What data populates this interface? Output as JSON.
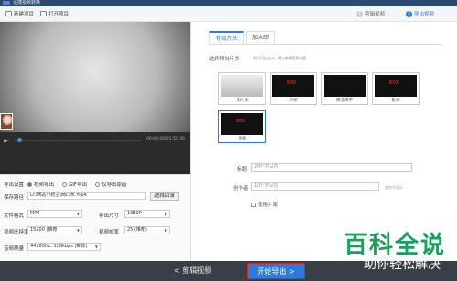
{
  "topbar": {
    "title": "迅捷视频转换"
  },
  "toolbar": {
    "new_project": "新建项目",
    "open_project": "打开项目",
    "steps": [
      {
        "num": "1",
        "label": "剪辑视频",
        "active": false
      },
      {
        "num": "2",
        "label": "导出视频",
        "active": true
      }
    ]
  },
  "player": {
    "timecode": "00:00:00/01:52:36"
  },
  "export": {
    "section_label": "导出设置",
    "options": [
      "视频导出",
      "GIF导出",
      "仅导出原音"
    ],
    "save_path_label": "保存路径",
    "save_path_value": "D:\\网站小粉主\\两口水.mp4",
    "browse_label": "选择目录",
    "format_label": "文件格式",
    "format_value": "MP4",
    "resolution_label": "导出尺寸",
    "resolution_value": "1080P",
    "video_bitrate_label": "视频比特率",
    "video_bitrate_value": "15500 (推荐)",
    "framerate_label": "视频帧率",
    "framerate_value": "25 (推荐)",
    "audio_label": "音频质量",
    "audio_value": "44100Hz, 128kbps (推荐)"
  },
  "right_panel": {
    "tabs": [
      "特效片头",
      "加水印"
    ],
    "choose_label": "选择特效片头",
    "choose_hint": "图片可自定义, 请在编辑面板设置",
    "cards": [
      {
        "caption": "无片头",
        "style": "light",
        "selected": false
      },
      {
        "caption": "时光",
        "style": "dark",
        "selected": false
      },
      {
        "caption": "腾漂白字",
        "style": "dark",
        "selected": false
      },
      {
        "caption": "影视",
        "style": "dark",
        "selected": false
      },
      {
        "caption": "移机",
        "style": "dark",
        "selected": true
      }
    ],
    "card_logo_text": "BOX",
    "title_label": "标题",
    "title_placeholder": "20个字以内",
    "author_label": "创作者",
    "author_placeholder": "10个字以内",
    "author_hint": "留空不显示",
    "checkbox_label": "使用片尾"
  },
  "bottombar": {
    "prev_label": "< 剪辑视频",
    "start_label": "开始导出 >"
  },
  "watermark": {
    "big": "百科全说",
    "small": "助你轻松解决"
  }
}
